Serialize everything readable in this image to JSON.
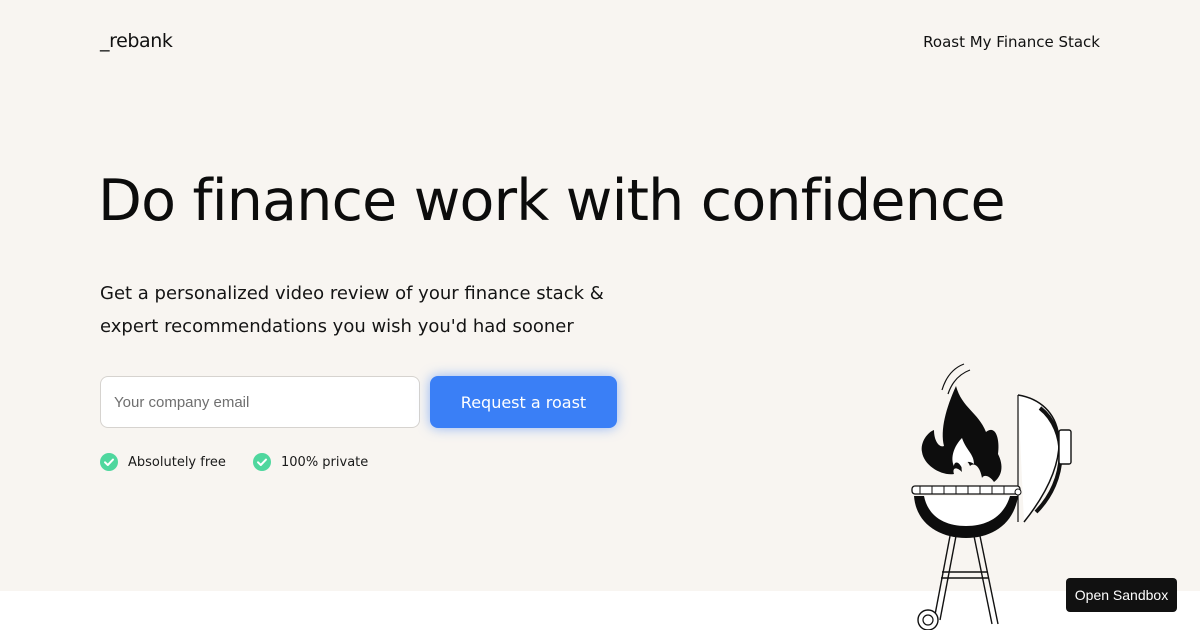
{
  "header": {
    "logo": "_rebank",
    "nav_link": "Roast My Finance Stack"
  },
  "hero": {
    "headline": "Do finance work with confidence",
    "subtext_line1": "Get a personalized video review of your finance stack &",
    "subtext_line2": "expert recommendations you wish you'd had sooner",
    "email_placeholder": "Your company email",
    "email_value": "",
    "cta_label": "Request a roast",
    "perks": [
      {
        "label": "Absolutely free",
        "icon": "check-circle-icon"
      },
      {
        "label": "100% private",
        "icon": "check-circle-icon"
      }
    ]
  },
  "illustration": {
    "icon": "bbq-grill-icon"
  },
  "sandbox": {
    "label": "Open Sandbox"
  },
  "colors": {
    "hero_background": "#f8f5f1",
    "page_background": "#ffffff",
    "accent": "#3a7ff6",
    "check": "#4fd79e",
    "text": "#0e0e0e",
    "sandbox_button": "#111111"
  }
}
